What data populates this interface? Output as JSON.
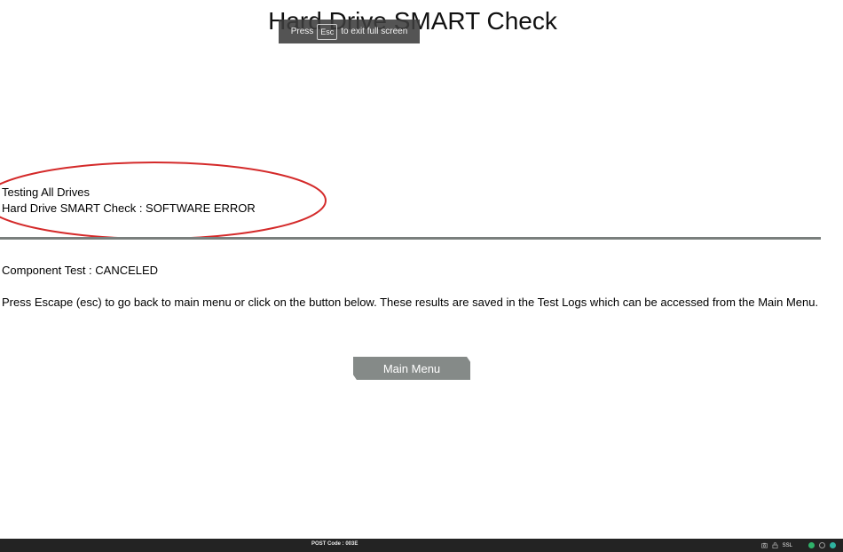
{
  "page": {
    "title": "Hard Drive SMART Check"
  },
  "fullscreen_toast": {
    "press": "Press",
    "key": "Esc",
    "suffix": "to exit full screen"
  },
  "status": {
    "line1": "Testing All Drives",
    "line2": "Hard Drive SMART Check : SOFTWARE ERROR"
  },
  "component_test": "Component Test : CANCELED",
  "instructions": "Press Escape (esc) to go back to main menu or click on the button below. These results are saved in the Test Logs which can be accessed from the Main Menu.",
  "main_menu_button": "Main Menu",
  "taskbar": {
    "post_code": "POST Code : 003E",
    "ssl_label": "SSL"
  },
  "colors": {
    "annotation_circle": "#d42a2a",
    "divider": "#7a7f7d",
    "button_bg": "#858a88",
    "taskbar_bg": "#232323"
  },
  "icons": [
    "camera-icon",
    "lock-icon",
    "status-ok-icon",
    "status-idle-icon",
    "status-connected-icon"
  ]
}
